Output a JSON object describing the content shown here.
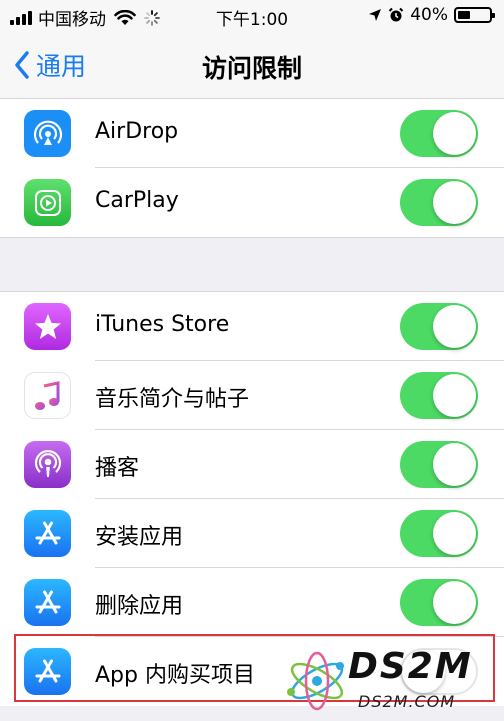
{
  "status_bar": {
    "carrier": "中国移动",
    "time": "下午1:00",
    "battery_percent": "40%",
    "battery_level": 0.4
  },
  "nav": {
    "back_label": "通用",
    "title": "访问限制"
  },
  "groups": [
    {
      "items": [
        {
          "label": "AirDrop",
          "icon": "airdrop-icon",
          "icon_color": "#1b8ff5",
          "enabled": true
        },
        {
          "label": "CarPlay",
          "icon": "carplay-icon",
          "icon_color": "#34c759",
          "enabled": true
        }
      ]
    },
    {
      "items": [
        {
          "label": "iTunes Store",
          "icon": "itunes-store-icon",
          "icon_color": "#c644fc",
          "enabled": true
        },
        {
          "label": "音乐简介与帖子",
          "icon": "music-icon",
          "icon_color": "#ffffff",
          "enabled": true
        },
        {
          "label": "播客",
          "icon": "podcasts-icon",
          "icon_color": "#9b45d6",
          "enabled": true
        },
        {
          "label": "安装应用",
          "icon": "app-store-icon",
          "icon_color": "#1c8ef9",
          "enabled": true
        },
        {
          "label": "删除应用",
          "icon": "app-store-icon",
          "icon_color": "#1c8ef9",
          "enabled": true
        },
        {
          "label": "App 内购买项目",
          "icon": "app-store-icon",
          "icon_color": "#1c8ef9",
          "enabled": false
        }
      ]
    }
  ],
  "colors": {
    "accent": "#1a7cf2",
    "toggle_on": "#4cd964",
    "highlight": "#d9363e"
  },
  "watermark": {
    "main": "DS2M",
    "sub": "DS2M.COM"
  }
}
